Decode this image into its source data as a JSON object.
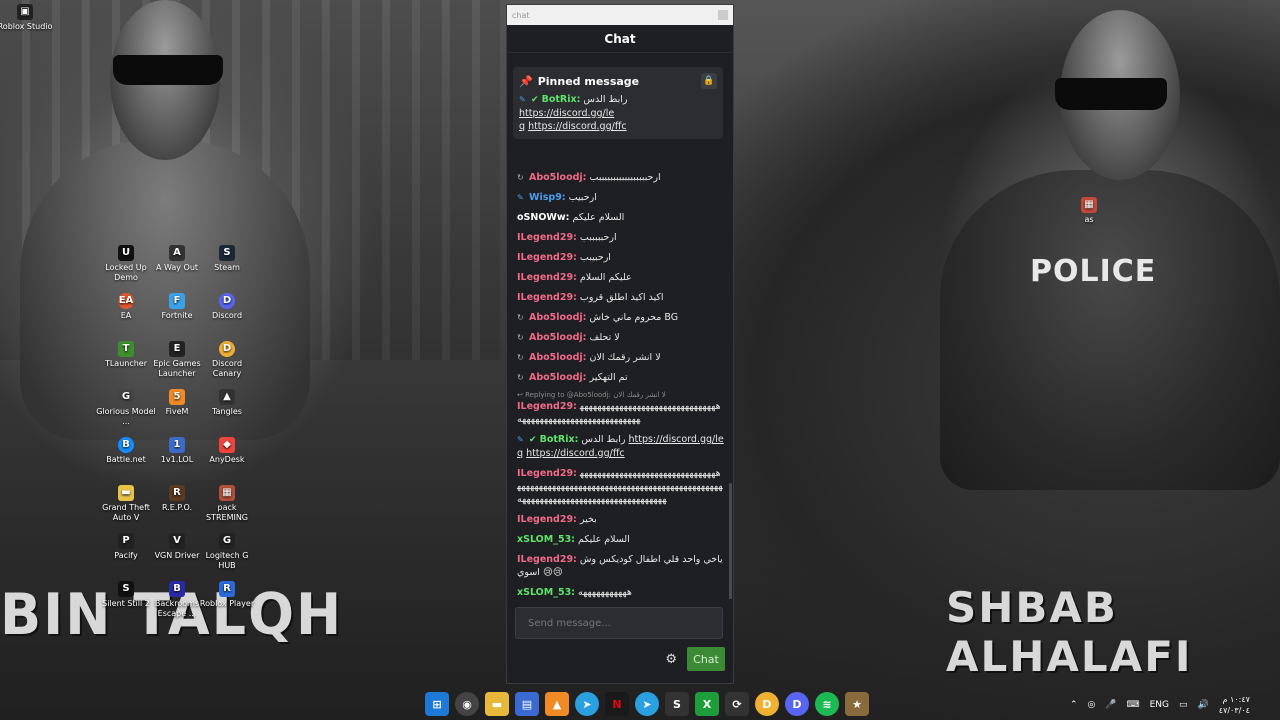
{
  "window": {
    "title": "chat",
    "header": "Chat"
  },
  "pinned": {
    "title": "Pinned message",
    "user": "BotRix:",
    "text": "رابط الدس",
    "link1": "https://discord.gg/le",
    "link1b": "q",
    "link2": "https://discord.gg/ffc"
  },
  "messages": [
    {
      "user": "Abo5loodj:",
      "text": "ارحبببببببببببببببببب",
      "color": "pink",
      "icon": "↻"
    },
    {
      "user": "Wisp9:",
      "text": "ارحبيب",
      "color": "blue",
      "icon": "✎"
    },
    {
      "user": "oSNOWw:",
      "text": "السلام عليكم",
      "color": "white",
      "icon": ""
    },
    {
      "user": "ILegend29:",
      "text": "ارحبببببب",
      "color": "pink",
      "icon": ""
    },
    {
      "user": "ILegend29:",
      "text": "ارحبيبب",
      "color": "pink",
      "icon": ""
    },
    {
      "user": "ILegend29:",
      "text": "عليكم السلام",
      "color": "pink",
      "icon": ""
    },
    {
      "user": "ILegend29:",
      "text": "اكيد اكيد اطلق قروب",
      "color": "pink",
      "icon": ""
    },
    {
      "user": "Abo5loodj:",
      "text": "محروم ماني خاش BG",
      "color": "pink",
      "icon": "↻"
    },
    {
      "user": "Abo5loodj:",
      "text": "لا تحلف",
      "color": "pink",
      "icon": "↻"
    },
    {
      "user": "Abo5loodj:",
      "text": "لا انشر رقمك الان",
      "color": "pink",
      "icon": "↻"
    },
    {
      "user": "Abo5loodj:",
      "text": "تم التهكير",
      "color": "pink",
      "icon": "↻"
    }
  ],
  "reply": {
    "label": "Replying to @Abo5loodj:",
    "quote": "لا انشر رقمك الان"
  },
  "messages2": [
    {
      "user": "ILegend29:",
      "text": "هههههههههههههههههههههههههههههههههههههههههههههههههههههههههههه",
      "color": "pink"
    }
  ],
  "bot2": {
    "user": "BotRix:",
    "text": "رابط الدس",
    "link1": "https://discord.gg/le",
    "link1b": "q",
    "link2": "https://discord.gg/ffc"
  },
  "messages3": [
    {
      "user": "ILegend29:",
      "text": "ههههههههههههههههههههههههههههههههههههههههههههههههههههههههههههههههههههههههههههههههههههههههههههههههههههههههههههههههه",
      "color": "pink"
    },
    {
      "user": "ILegend29:",
      "text": "بخير",
      "color": "pink"
    },
    {
      "user": "xSLOM_53:",
      "text": "السلام عليكم",
      "color": "green"
    },
    {
      "user": "ILegend29:",
      "text": "ياخي واحد قلي اطفال كوديكس وش اسوي 😢😢",
      "color": "pink"
    },
    {
      "user": "xSLOM_53:",
      "text": "هههههههههههه",
      "color": "green"
    }
  ],
  "input": {
    "placeholder": "Send message..."
  },
  "send_label": "Chat",
  "desktop": {
    "roblox_studio": "Roblox Studio",
    "locked_up": "Locked Up Demo",
    "a_way_out": "A Way Out",
    "steam": "Steam",
    "ea": "EA",
    "fortnite": "Fortnite",
    "discord": "Discord",
    "tlauncher": "TLauncher",
    "epic": "Epic Games Launcher",
    "discord_canary": "Discord Canary",
    "glorious": "Glorious Model ...",
    "fivem": "FiveM",
    "tangles": "Tangles",
    "battlenet": "Battle.net",
    "onev1": "1v1.LOL",
    "anydesk": "AnyDesk",
    "gta": "Grand Theft Auto V",
    "repo": "R.E.P.O.",
    "pack": "pack STREMING",
    "pacify": "Pacify",
    "vgn": "VGN Driver",
    "logitech": "Logitech G HUB",
    "silent": "Silent Still 2",
    "backrooms": "Backrooms Escape ...",
    "roblox_player": "Roblox Player",
    "as": "as"
  },
  "wallpaper": {
    "left_text": "BIN TALQH",
    "right_text": "SHBAB ALHALAFI",
    "badge": "POLICE"
  },
  "tray": {
    "lang": "ENG",
    "time": "١٠:٤٧ م",
    "date": "٤٧/٠٣/٠٤"
  },
  "colors": {
    "accent_green": "#3d8a36",
    "pink_user": "#f06a8a",
    "green_user": "#5fe36a",
    "blue_user": "#4c9df0"
  }
}
